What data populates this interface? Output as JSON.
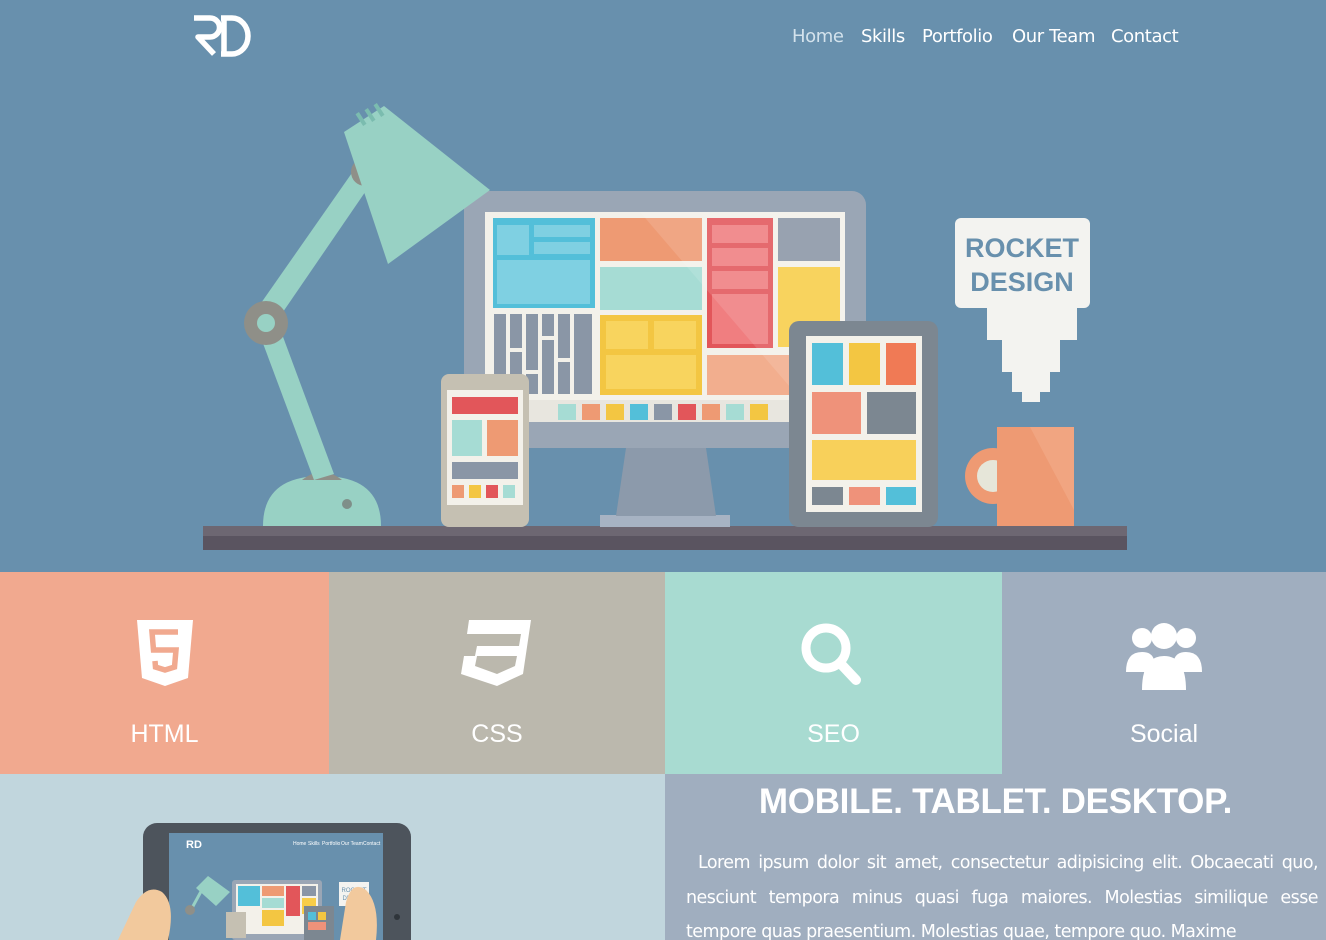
{
  "brand": {
    "logo_text": "RD"
  },
  "nav": {
    "items": [
      {
        "label": "Home",
        "active": true
      },
      {
        "label": "Skills",
        "active": false
      },
      {
        "label": "Portfolio",
        "active": false
      },
      {
        "label": "Our Team",
        "active": false
      },
      {
        "label": "Contact",
        "active": false
      }
    ]
  },
  "hero": {
    "sign_line1": "ROCKET",
    "sign_line2": "DESIGN",
    "illustration": "desk-lamp-monitor-phone-tablet-mug"
  },
  "skills": [
    {
      "label": "HTML",
      "icon": "html5-icon",
      "color": "#f1a98f"
    },
    {
      "label": "CSS",
      "icon": "css3-icon",
      "color": "#bbb8ad"
    },
    {
      "label": "SEO",
      "icon": "search-icon",
      "color": "#a8dbd1"
    },
    {
      "label": "Social",
      "icon": "users-icon",
      "color": "#a0aebf"
    }
  ],
  "responsive": {
    "headline": "MOBILE. TABLET. DESKTOP.",
    "paragraph": "Lorem ipsum dolor sit amet, consectetur adipisicing elit. Obcaecati quo, nesciunt tempora minus quasi fuga maiores. Molestias similique esse tempore quas praesentium. Molestias quae, tempore quo. Maxime",
    "mini_nav": [
      "Home",
      "Skills",
      "Portfolio",
      "Our Team",
      "Contact"
    ],
    "mini_sign_line1": "ROCKET",
    "mini_sign_line2": "DESIGN"
  },
  "colors": {
    "hero_bg": "#6890ad",
    "html": "#f1a98f",
    "css": "#bbb8ad",
    "seo": "#a8dbd1",
    "social": "#a0aebf",
    "bottom_left": "#c1d6dd"
  }
}
